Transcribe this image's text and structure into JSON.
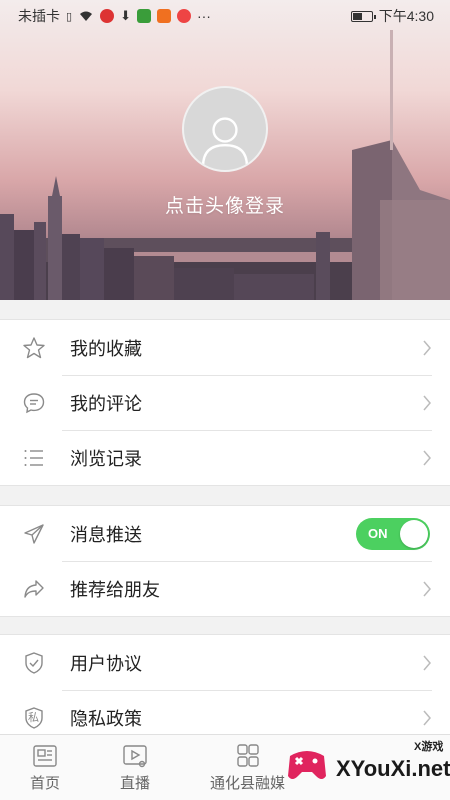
{
  "status_bar": {
    "carrier": "未插卡",
    "time": "下午4:30",
    "more": "···"
  },
  "profile": {
    "login_prompt": "点击头像登录"
  },
  "menu_group_1": [
    {
      "label": "我的收藏",
      "icon": "star-icon"
    },
    {
      "label": "我的评论",
      "icon": "comment-icon"
    },
    {
      "label": "浏览记录",
      "icon": "list-icon"
    }
  ],
  "menu_group_2": [
    {
      "label": "消息推送",
      "icon": "send-icon",
      "toggle": "ON"
    },
    {
      "label": "推荐给朋友",
      "icon": "share-icon"
    }
  ],
  "menu_group_3": [
    {
      "label": "用户协议",
      "icon": "shield-check-icon"
    },
    {
      "label": "隐私政策",
      "icon": "privacy-shield-icon",
      "icon_char": "私"
    }
  ],
  "tabs": [
    {
      "label": "首页",
      "icon": "news-icon"
    },
    {
      "label": "直播",
      "icon": "live-icon"
    },
    {
      "label": "通化县融媒",
      "icon": "grid-icon"
    }
  ],
  "watermark": {
    "text": "XYouXi.net",
    "small": "X游戏"
  },
  "colors": {
    "toggle_on": "#4cd060",
    "icon_gray": "#8a8a8a"
  }
}
